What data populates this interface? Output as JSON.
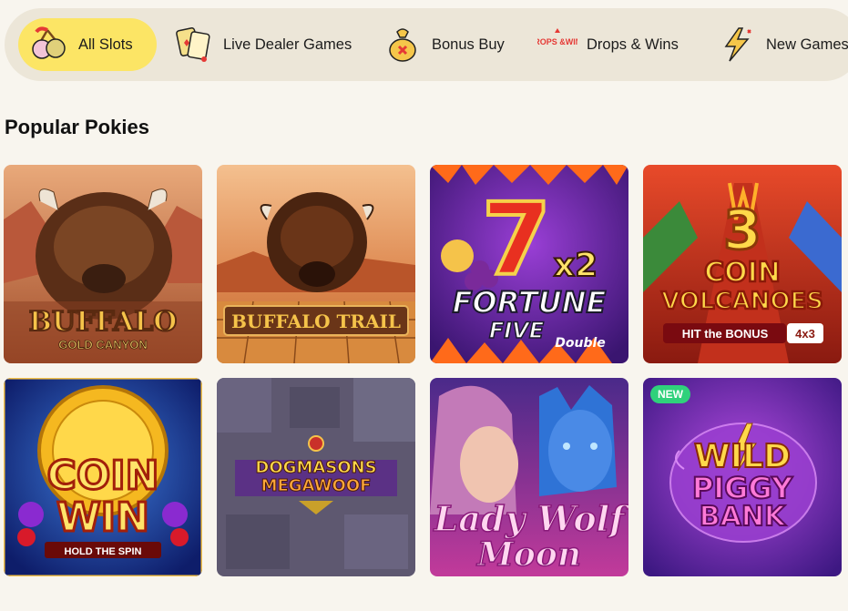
{
  "tabs": [
    {
      "label": "All Slots",
      "icon": "cherries-icon",
      "active": true
    },
    {
      "label": "Live Dealer Games",
      "icon": "playing-cards-icon",
      "active": false
    },
    {
      "label": "Bonus Buy",
      "icon": "money-bag-icon",
      "active": false
    },
    {
      "label": "Drops & Wins",
      "icon": "drops-wins-icon",
      "icon_text": "DROPS &WINS",
      "active": false
    },
    {
      "label": "New Games",
      "icon": "lightning-icon",
      "active": false
    }
  ],
  "section": {
    "title": "Popular Pokies"
  },
  "games": [
    {
      "title": "BUFFALO",
      "subtitle": "GOLD CANYON"
    },
    {
      "title": "BUFFALO TRAIL"
    },
    {
      "title": "FORTUNE",
      "subtitle": "FIVE",
      "extra": "Double",
      "badge_text": "7",
      "multiplier": "x2"
    },
    {
      "title": "COIN",
      "subtitle": "VOLCANOES",
      "number": "3",
      "tag": "HIT the BONUS",
      "tag_value": "4x3"
    },
    {
      "title": "COIN",
      "subtitle": "WIN",
      "tag": "HOLD THE SPIN"
    },
    {
      "title": "DOGMASONS",
      "subtitle": "MEGAWOOF"
    },
    {
      "title": "Lady Wolf",
      "subtitle": "Moon"
    },
    {
      "title": "WILD",
      "subtitle": "PIGGY",
      "extra": "BANK",
      "badge": "NEW"
    }
  ],
  "colors": {
    "active_tab": "#fce565",
    "tab_bar": "#ece6d8",
    "page_bg": "#f8f5ee",
    "new_badge": "#2fd17b"
  }
}
